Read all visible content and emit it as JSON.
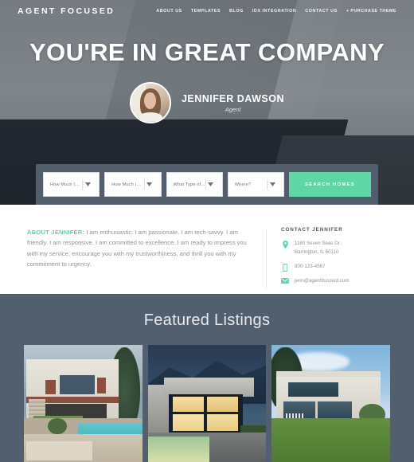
{
  "nav": {
    "logo": "AGENT FOCUSED",
    "links": [
      {
        "label": "ABOUT US"
      },
      {
        "label": "TEMPLATES"
      },
      {
        "label": "BLOG"
      },
      {
        "label": "IDX INTEGRATION"
      },
      {
        "label": "CONTACT US"
      },
      {
        "label": "+ PURCHASE THEME"
      }
    ]
  },
  "hero": {
    "title": "YOU'RE IN GREAT COMPANY",
    "agent_name": "JENNIFER DAWSON",
    "agent_role": "Agent",
    "avatar_alt": "agent-portrait"
  },
  "search": {
    "fields": [
      {
        "label": "How Much (Max)?"
      },
      {
        "label": "How Much (Min)?"
      },
      {
        "label": "What Type of Home?"
      },
      {
        "label": "Where?"
      }
    ],
    "button_label": "SEARCH HOMES",
    "button_color": "#5fd6a6",
    "bar_color": "#535e6d"
  },
  "about": {
    "lead": "ABOUT JENNIFER:",
    "body": " I am enthusiastic. I am passionate. I am tech-savvy. I am friendly. I am responsive. I am committed to excellence. I am ready to impress you with my service, encourage you with my trustworthiness, and thrill you with my commitment to urgency.",
    "accent_color": "#5fd6a6"
  },
  "contact": {
    "title": "CONTACT JENNIFER",
    "address_line1": "1180 Seven Seas Dr.",
    "address_line2": "Barrington, IL 60110",
    "phone": "800-123-4567",
    "email": "jenn@agentfocused.com"
  },
  "featured": {
    "title": "Featured Listings",
    "background": "#525f6e",
    "listings": [
      {
        "alt": "white-villa-with-pool"
      },
      {
        "alt": "modern-house-lit-at-dusk"
      },
      {
        "alt": "concrete-modern-house-with-lawn"
      }
    ]
  }
}
